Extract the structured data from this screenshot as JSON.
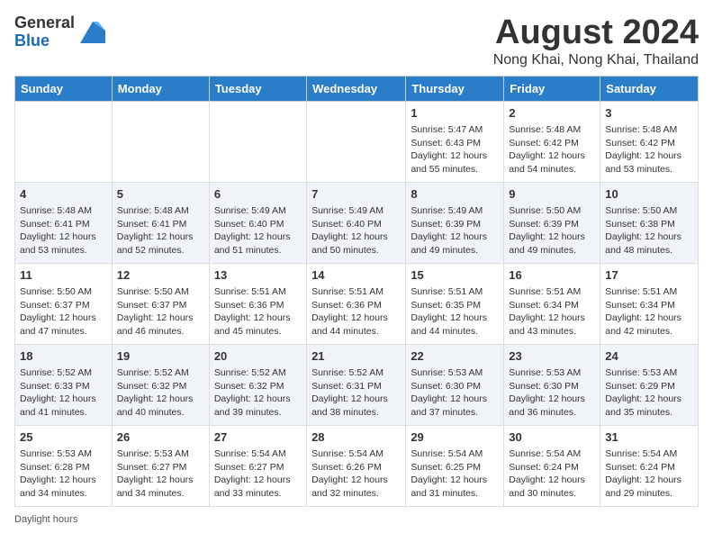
{
  "header": {
    "logo_line1": "General",
    "logo_line2": "Blue",
    "main_title": "August 2024",
    "subtitle": "Nong Khai, Nong Khai, Thailand"
  },
  "calendar": {
    "days_of_week": [
      "Sunday",
      "Monday",
      "Tuesday",
      "Wednesday",
      "Thursday",
      "Friday",
      "Saturday"
    ],
    "weeks": [
      [
        {
          "day": "",
          "content": ""
        },
        {
          "day": "",
          "content": ""
        },
        {
          "day": "",
          "content": ""
        },
        {
          "day": "",
          "content": ""
        },
        {
          "day": "1",
          "content": "Sunrise: 5:47 AM\nSunset: 6:43 PM\nDaylight: 12 hours and 55 minutes."
        },
        {
          "day": "2",
          "content": "Sunrise: 5:48 AM\nSunset: 6:42 PM\nDaylight: 12 hours and 54 minutes."
        },
        {
          "day": "3",
          "content": "Sunrise: 5:48 AM\nSunset: 6:42 PM\nDaylight: 12 hours and 53 minutes."
        }
      ],
      [
        {
          "day": "4",
          "content": "Sunrise: 5:48 AM\nSunset: 6:41 PM\nDaylight: 12 hours and 53 minutes."
        },
        {
          "day": "5",
          "content": "Sunrise: 5:48 AM\nSunset: 6:41 PM\nDaylight: 12 hours and 52 minutes."
        },
        {
          "day": "6",
          "content": "Sunrise: 5:49 AM\nSunset: 6:40 PM\nDaylight: 12 hours and 51 minutes."
        },
        {
          "day": "7",
          "content": "Sunrise: 5:49 AM\nSunset: 6:40 PM\nDaylight: 12 hours and 50 minutes."
        },
        {
          "day": "8",
          "content": "Sunrise: 5:49 AM\nSunset: 6:39 PM\nDaylight: 12 hours and 49 minutes."
        },
        {
          "day": "9",
          "content": "Sunrise: 5:50 AM\nSunset: 6:39 PM\nDaylight: 12 hours and 49 minutes."
        },
        {
          "day": "10",
          "content": "Sunrise: 5:50 AM\nSunset: 6:38 PM\nDaylight: 12 hours and 48 minutes."
        }
      ],
      [
        {
          "day": "11",
          "content": "Sunrise: 5:50 AM\nSunset: 6:37 PM\nDaylight: 12 hours and 47 minutes."
        },
        {
          "day": "12",
          "content": "Sunrise: 5:50 AM\nSunset: 6:37 PM\nDaylight: 12 hours and 46 minutes."
        },
        {
          "day": "13",
          "content": "Sunrise: 5:51 AM\nSunset: 6:36 PM\nDaylight: 12 hours and 45 minutes."
        },
        {
          "day": "14",
          "content": "Sunrise: 5:51 AM\nSunset: 6:36 PM\nDaylight: 12 hours and 44 minutes."
        },
        {
          "day": "15",
          "content": "Sunrise: 5:51 AM\nSunset: 6:35 PM\nDaylight: 12 hours and 44 minutes."
        },
        {
          "day": "16",
          "content": "Sunrise: 5:51 AM\nSunset: 6:34 PM\nDaylight: 12 hours and 43 minutes."
        },
        {
          "day": "17",
          "content": "Sunrise: 5:51 AM\nSunset: 6:34 PM\nDaylight: 12 hours and 42 minutes."
        }
      ],
      [
        {
          "day": "18",
          "content": "Sunrise: 5:52 AM\nSunset: 6:33 PM\nDaylight: 12 hours and 41 minutes."
        },
        {
          "day": "19",
          "content": "Sunrise: 5:52 AM\nSunset: 6:32 PM\nDaylight: 12 hours and 40 minutes."
        },
        {
          "day": "20",
          "content": "Sunrise: 5:52 AM\nSunset: 6:32 PM\nDaylight: 12 hours and 39 minutes."
        },
        {
          "day": "21",
          "content": "Sunrise: 5:52 AM\nSunset: 6:31 PM\nDaylight: 12 hours and 38 minutes."
        },
        {
          "day": "22",
          "content": "Sunrise: 5:53 AM\nSunset: 6:30 PM\nDaylight: 12 hours and 37 minutes."
        },
        {
          "day": "23",
          "content": "Sunrise: 5:53 AM\nSunset: 6:30 PM\nDaylight: 12 hours and 36 minutes."
        },
        {
          "day": "24",
          "content": "Sunrise: 5:53 AM\nSunset: 6:29 PM\nDaylight: 12 hours and 35 minutes."
        }
      ],
      [
        {
          "day": "25",
          "content": "Sunrise: 5:53 AM\nSunset: 6:28 PM\nDaylight: 12 hours and 34 minutes."
        },
        {
          "day": "26",
          "content": "Sunrise: 5:53 AM\nSunset: 6:27 PM\nDaylight: 12 hours and 34 minutes."
        },
        {
          "day": "27",
          "content": "Sunrise: 5:54 AM\nSunset: 6:27 PM\nDaylight: 12 hours and 33 minutes."
        },
        {
          "day": "28",
          "content": "Sunrise: 5:54 AM\nSunset: 6:26 PM\nDaylight: 12 hours and 32 minutes."
        },
        {
          "day": "29",
          "content": "Sunrise: 5:54 AM\nSunset: 6:25 PM\nDaylight: 12 hours and 31 minutes."
        },
        {
          "day": "30",
          "content": "Sunrise: 5:54 AM\nSunset: 6:24 PM\nDaylight: 12 hours and 30 minutes."
        },
        {
          "day": "31",
          "content": "Sunrise: 5:54 AM\nSunset: 6:24 PM\nDaylight: 12 hours and 29 minutes."
        }
      ]
    ]
  },
  "legend": {
    "daylight_hours_label": "Daylight hours"
  }
}
